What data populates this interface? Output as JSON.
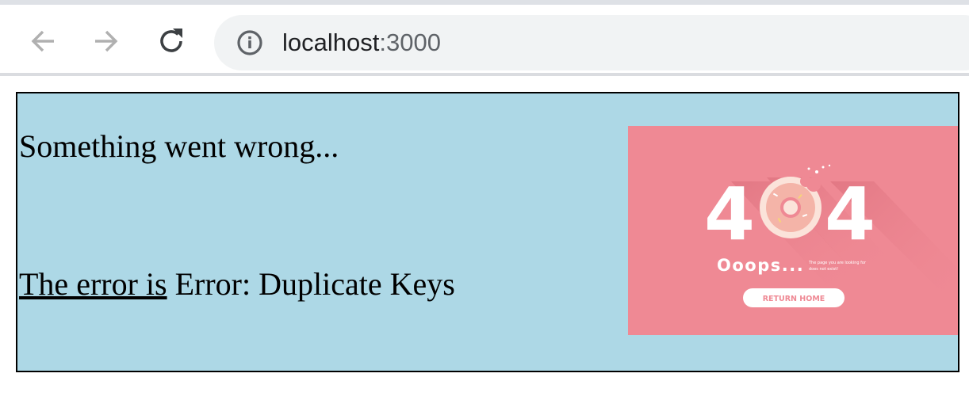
{
  "browser": {
    "url_host": "localhost",
    "url_port": ":3000",
    "icons": {
      "back": "arrow-left-icon",
      "forward": "arrow-right-icon",
      "reload": "reload-icon",
      "site_info": "info-icon"
    }
  },
  "page": {
    "background_color": "#add8e6",
    "title": "Something went wrong...",
    "error_label": "The error is",
    "error_message": " Error: Duplicate Keys",
    "illustration": {
      "code_left": "4",
      "code_right": "4",
      "headline": "Ooops...",
      "subtext_line1": "The page you are looking for",
      "subtext_line2": "does not exist!",
      "button_label": "RETURN HOME",
      "background_color": "#ef8994"
    }
  }
}
